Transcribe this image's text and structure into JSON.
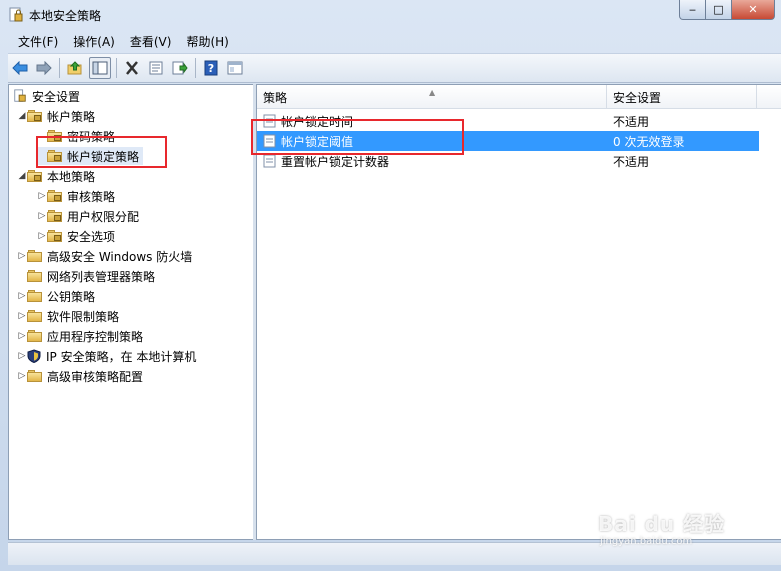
{
  "window": {
    "title": "本地安全策略"
  },
  "menu": [
    "文件(F)",
    "操作(A)",
    "查看(V)",
    "帮助(H)"
  ],
  "toolbar": {
    "icons": [
      "back-icon",
      "forward-icon",
      "up-folder-icon",
      "show-hide-tree-icon",
      "delete-icon",
      "properties-icon",
      "export-icon",
      "help-icon",
      "console-icon"
    ]
  },
  "tree": {
    "root": "安全设置",
    "account_policies": "帐户策略",
    "password_policy": "密码策略",
    "lockout_policy": "帐户锁定策略",
    "local_policies": "本地策略",
    "audit_policy": "审核策略",
    "user_rights": "用户权限分配",
    "security_options": "安全选项",
    "firewall": "高级安全 Windows 防火墙",
    "network_list": "网络列表管理器策略",
    "public_key": "公钥策略",
    "software_restriction": "软件限制策略",
    "app_control": "应用程序控制策略",
    "ipsec": "IP 安全策略，在 本地计算机",
    "advanced_audit": "高级审核策略配置"
  },
  "list": {
    "columns": [
      "策略",
      "安全设置"
    ],
    "rows": [
      {
        "name": "帐户锁定时间",
        "value": "不适用",
        "selected": false
      },
      {
        "name": "帐户锁定阈值",
        "value": "0 次无效登录",
        "selected": true
      },
      {
        "name": "重置帐户锁定计数器",
        "value": "不适用",
        "selected": false
      }
    ]
  },
  "watermark": {
    "main": "Bai du 经验",
    "sub": "jingyan.baidu.com"
  },
  "colors": {
    "selection": "#3399ff",
    "highlight_box": "#e8282d"
  }
}
